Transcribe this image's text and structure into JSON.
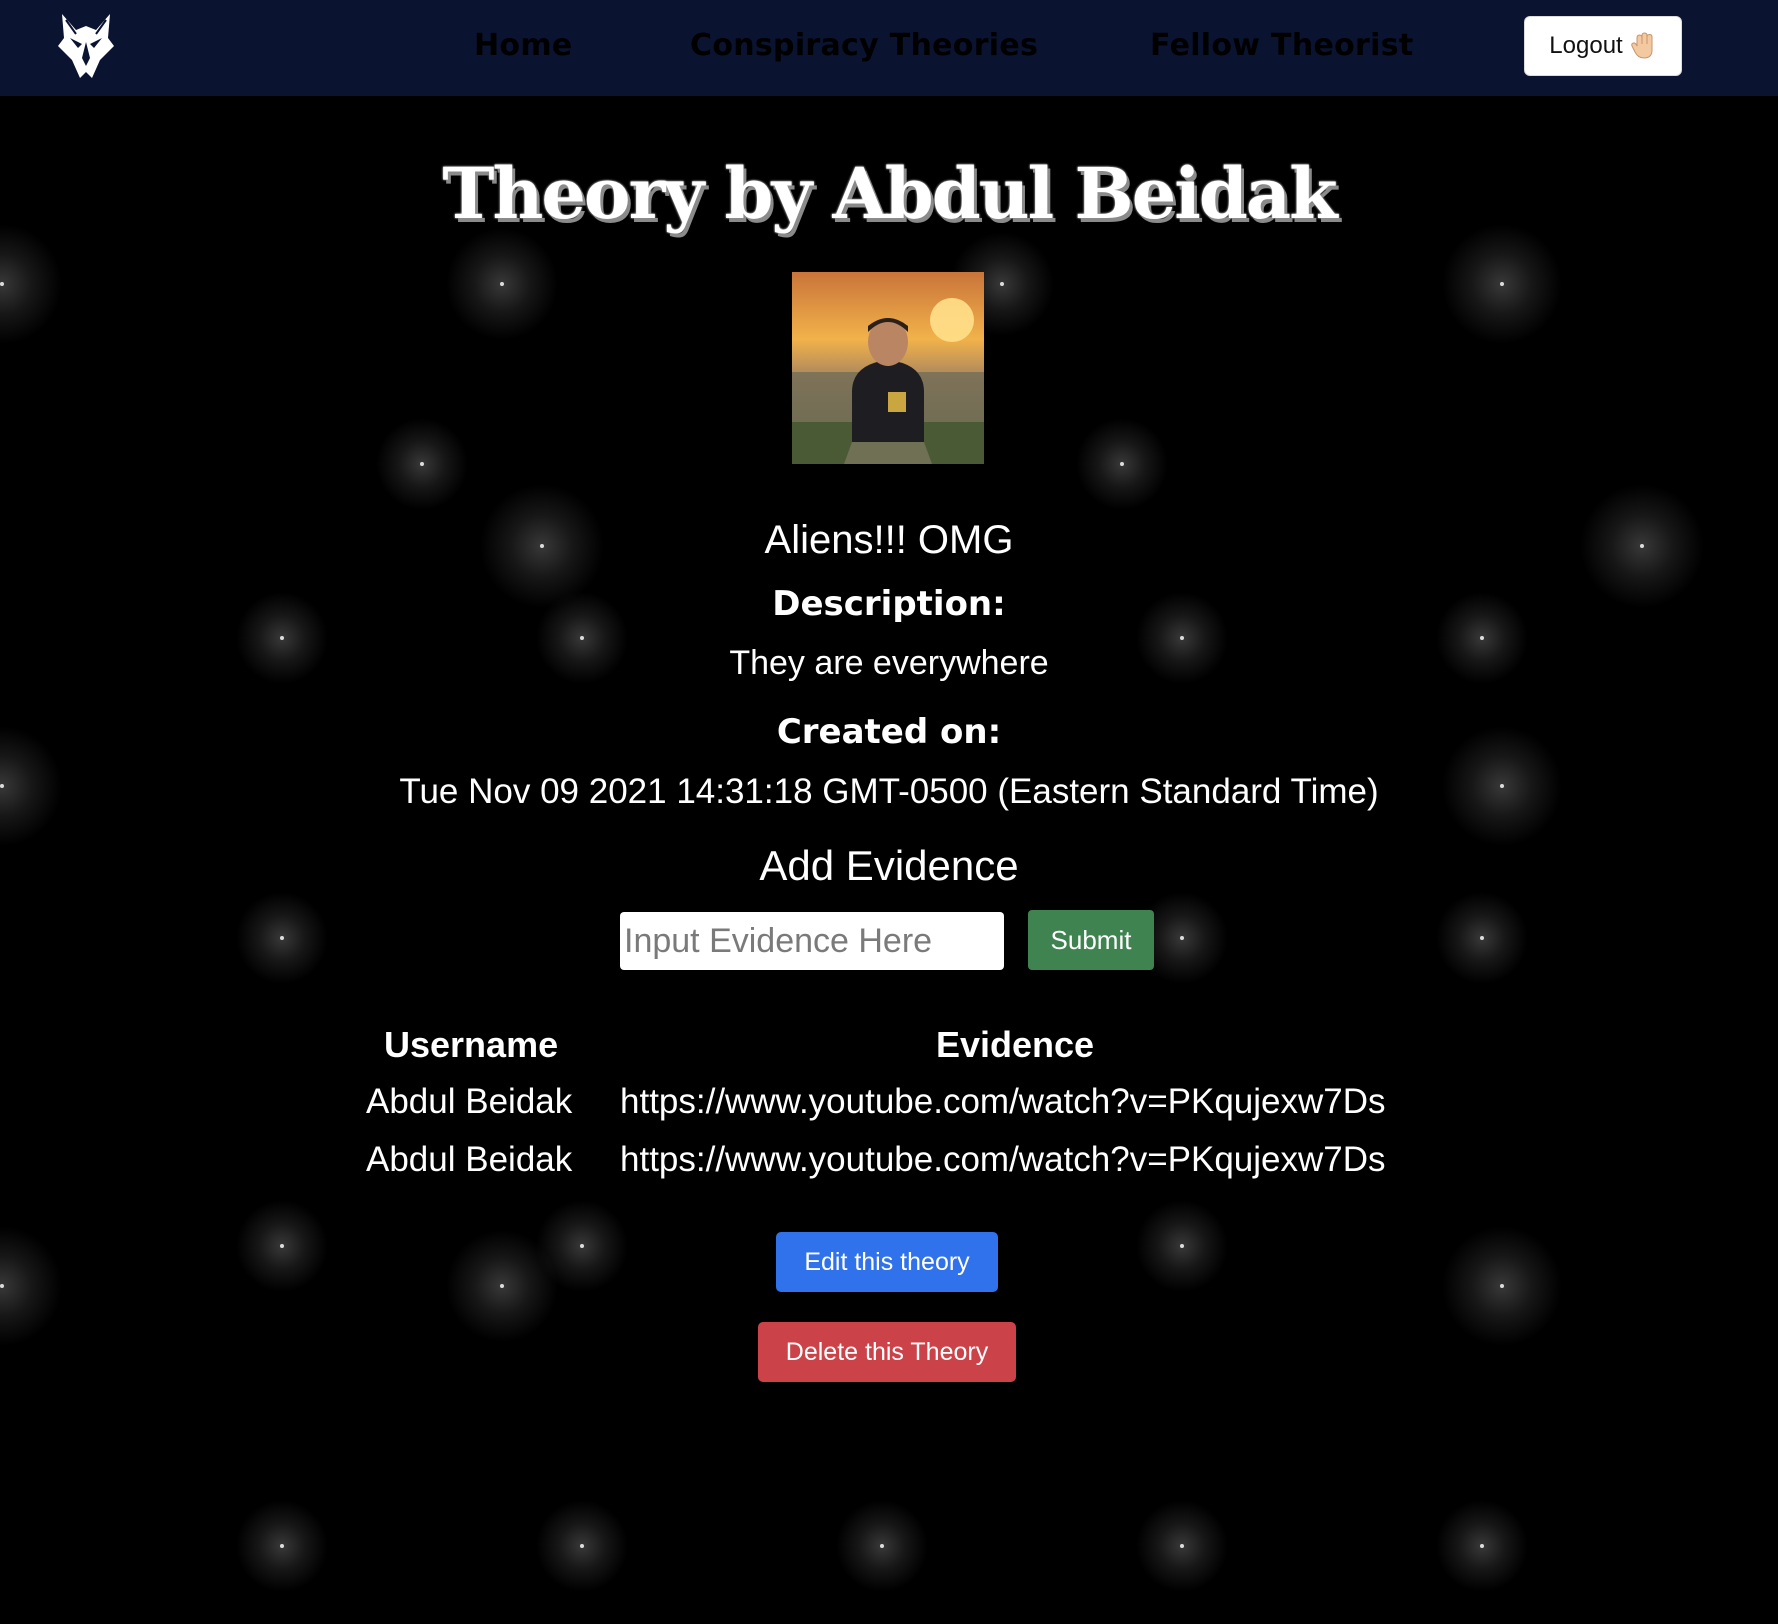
{
  "navbar": {
    "links": [
      "Home",
      "Conspiracy Theories",
      "Fellow Theorist"
    ],
    "logout_label": "Logout",
    "logout_icon": "waving-hand-icon"
  },
  "main": {
    "title": "Theory by Abdul Beidak",
    "theory_name": "Aliens!!! OMG",
    "description_label": "Description:",
    "description": "They are everywhere",
    "created_label": "Created on:",
    "created": "Tue Nov 09 2021 14:31:18 GMT-0500 (Eastern Standard Time)",
    "add_evidence_heading": "Add Evidence",
    "evidence_placeholder": "Input Evidence Here",
    "submit_label": "Submit"
  },
  "evidence_table": {
    "headers": [
      "Username",
      "Evidence"
    ],
    "rows": [
      [
        "Abdul Beidak",
        "https://www.youtube.com/watch?v=PKqujexw7Ds"
      ],
      [
        "Abdul Beidak",
        "https://www.youtube.com/watch?v=PKqujexw7Ds"
      ]
    ]
  },
  "actions": {
    "edit_label": "Edit this theory",
    "delete_label": "Delete this Theory"
  },
  "colors": {
    "navbar_bg": "#0a1330",
    "page_bg": "#000000",
    "submit_green": "#3f8450",
    "edit_blue": "#2f72ec",
    "delete_red": "#cc4249"
  }
}
